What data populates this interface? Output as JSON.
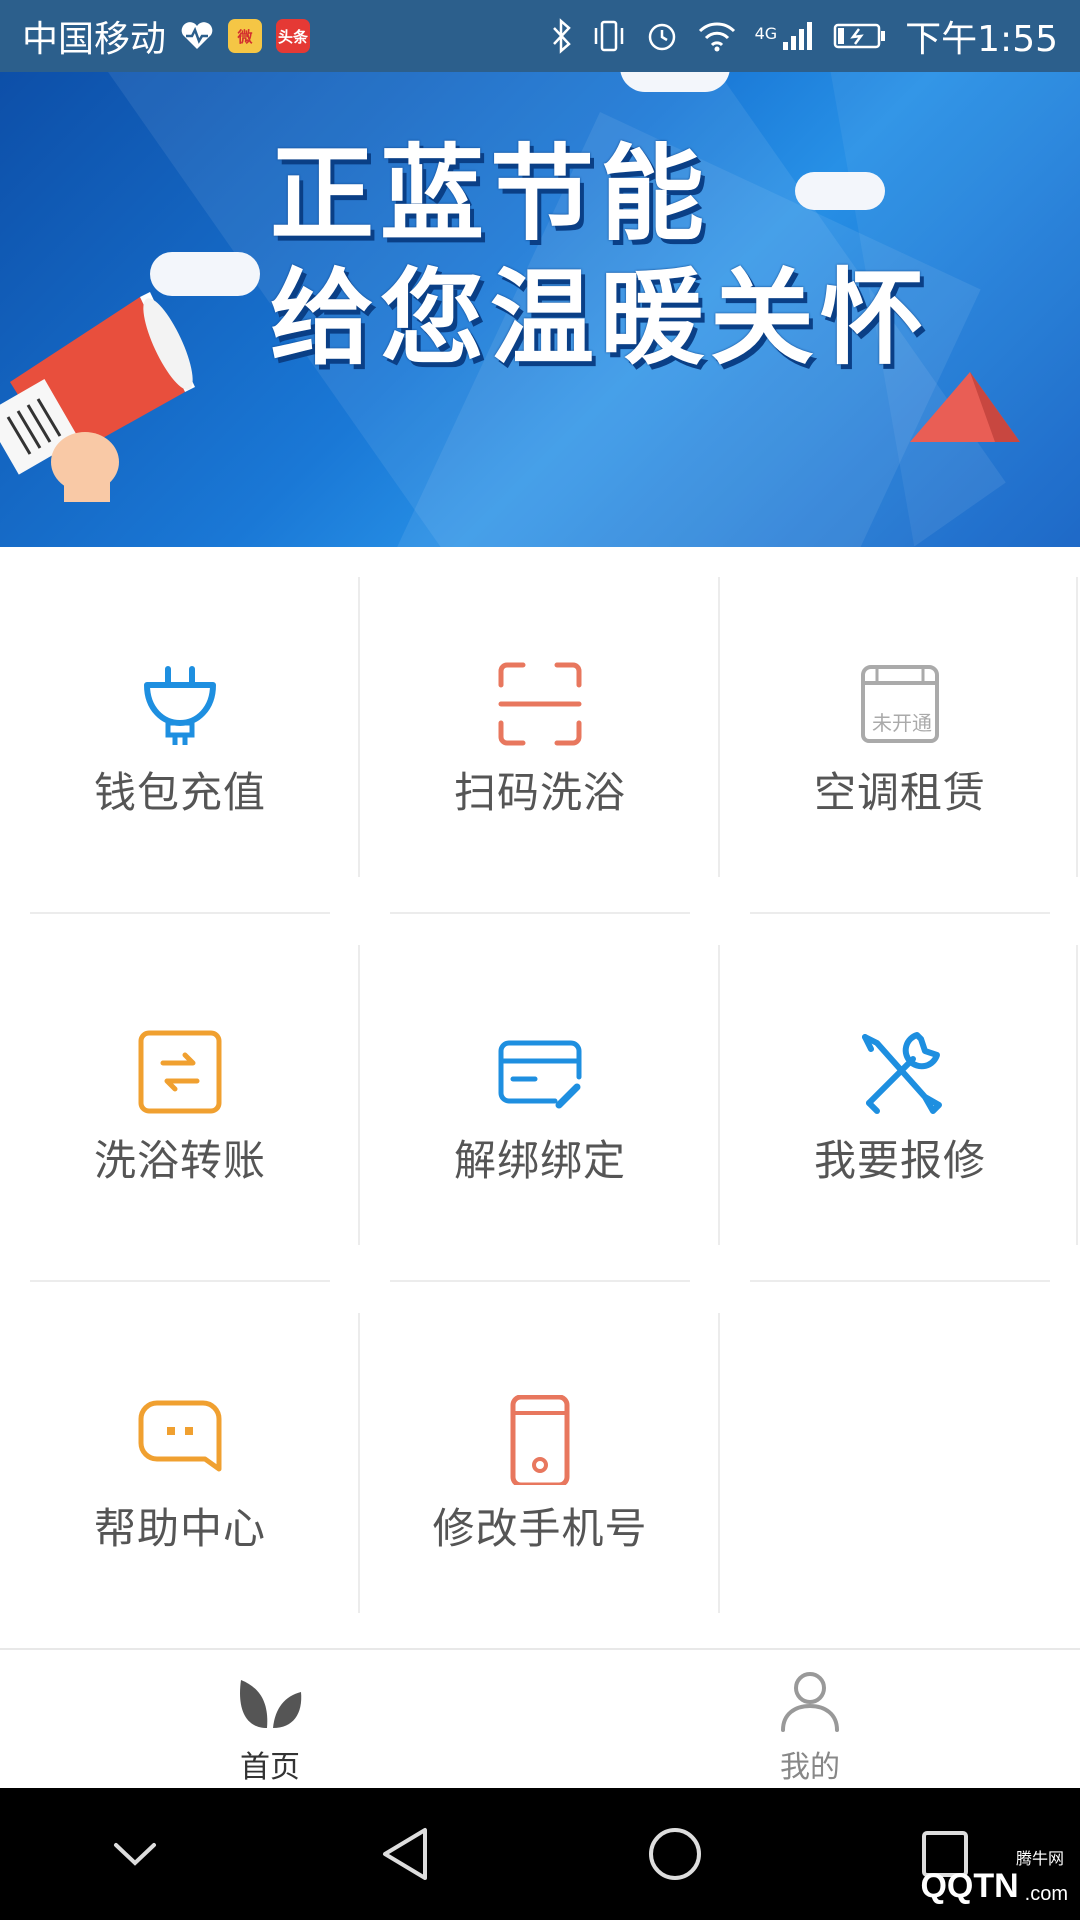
{
  "status_bar": {
    "carrier": "中国移动",
    "app_weibo": "微",
    "app_toutiao": "头条",
    "network": "4G",
    "time": "下午1:55"
  },
  "banner": {
    "line1": "正蓝节能",
    "line2": "给您温暖关怀"
  },
  "grid": {
    "items": [
      {
        "label": "钱包充值",
        "icon": "plug-icon",
        "color": "#1e8fe0"
      },
      {
        "label": "扫码洗浴",
        "icon": "scan-icon",
        "color": "#e8775e"
      },
      {
        "label": "空调租赁",
        "icon": "air-conditioner-icon",
        "color": "#aaaaaa",
        "badge": "未开通"
      },
      {
        "label": "洗浴转账",
        "icon": "transfer-icon",
        "color": "#f0a030"
      },
      {
        "label": "解绑绑定",
        "icon": "card-icon",
        "color": "#1e8fe0"
      },
      {
        "label": "我要报修",
        "icon": "repair-tools-icon",
        "color": "#1e8fe0"
      },
      {
        "label": "帮助中心",
        "icon": "chat-bubble-icon",
        "color": "#f0a030"
      },
      {
        "label": "修改手机号",
        "icon": "phone-icon",
        "color": "#e8775e"
      }
    ]
  },
  "bottom_nav": {
    "tabs": [
      {
        "label": "首页",
        "icon": "leaf-icon",
        "active": true
      },
      {
        "label": "我的",
        "icon": "user-icon",
        "active": false
      }
    ]
  },
  "watermark": {
    "brand": "QQTN",
    "suffix": ".com",
    "tag": "腾牛网"
  }
}
